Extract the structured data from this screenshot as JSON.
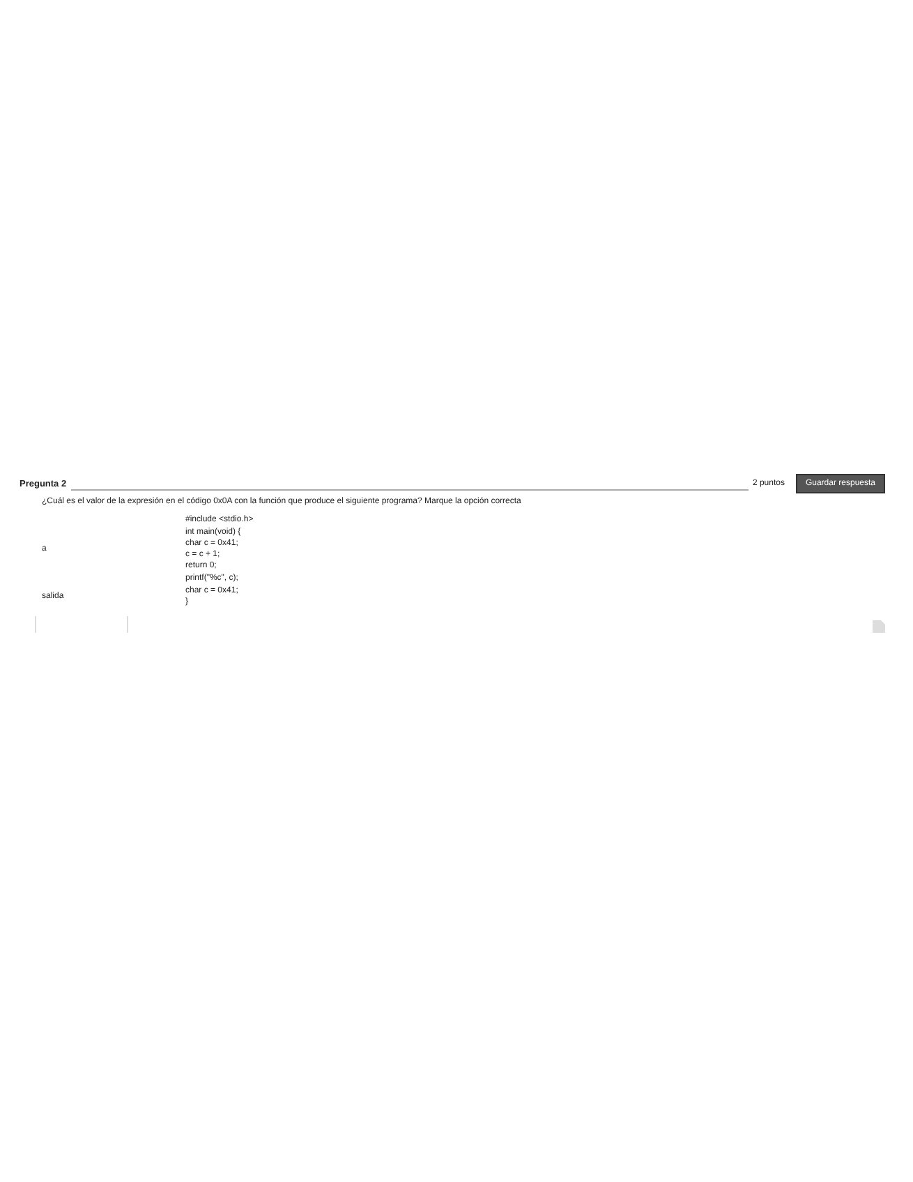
{
  "question": {
    "title": "Pregunta 2",
    "points": "2 puntos",
    "save_button": "Guardar respuesta",
    "prompt": "¿Cuál es el valor de la expresión en el código 0x0A con la función que produce el siguiente programa? Marque la opción correcta",
    "rows": [
      {
        "label": "",
        "lines": [
          "#include <stdio.h>"
        ]
      },
      {
        "label": "a",
        "lines": [
          "int main(void) {",
          "  char c = 0x41;",
          "  c = c + 1;",
          "  return 0;"
        ]
      },
      {
        "label": "",
        "lines": [
          "printf(\"%c\", c);"
        ]
      },
      {
        "label": "salida",
        "lines": [
          "char c = 0x41;",
          "}"
        ]
      }
    ]
  }
}
